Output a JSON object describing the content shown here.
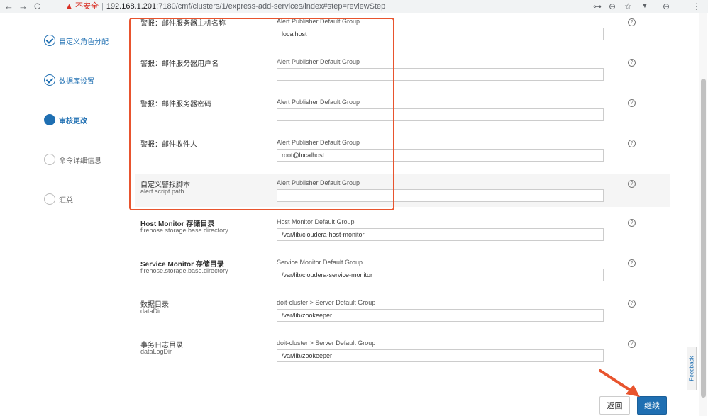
{
  "browser": {
    "back": "←",
    "forward": "→",
    "reload": "C",
    "security_text": "▲ 不安全",
    "host": "192.168.1.201",
    "path": ":7180/cmf/clusters/1/express-add-services/index#step=reviewStep",
    "key_icon": "⊶",
    "zoom_icon": "⊖",
    "star_icon": "☆",
    "ext_icon": "▼",
    "account_icon": "⊖",
    "menu_icon": "⋮"
  },
  "steps": [
    {
      "label": "自定义角色分配",
      "state": "done"
    },
    {
      "label": "数据库设置",
      "state": "done"
    },
    {
      "label": "审核更改",
      "state": "active"
    },
    {
      "label": "命令详细信息",
      "state": "pending"
    },
    {
      "label": "汇总",
      "state": "pending"
    }
  ],
  "configs": [
    {
      "title": "警报：邮件服务器主机名称",
      "sub": "",
      "group": "Alert Publisher Default Group",
      "value": "localhost"
    },
    {
      "title": "警报：邮件服务器用户名",
      "sub": "",
      "group": "Alert Publisher Default Group",
      "value": ""
    },
    {
      "title": "警报：邮件服务器密码",
      "sub": "",
      "group": "Alert Publisher Default Group",
      "value": ""
    },
    {
      "title": "警报：邮件收件人",
      "sub": "",
      "group": "Alert Publisher Default Group",
      "value": "root@localhost"
    },
    {
      "title": "自定义警报脚本",
      "sub": "alert.script.path",
      "group": "Alert Publisher Default Group",
      "value": ""
    },
    {
      "title": "Host Monitor 存储目录",
      "sub": "firehose.storage.base.directory",
      "group": "Host Monitor Default Group",
      "value": "/var/lib/cloudera-host-monitor"
    },
    {
      "title": "Service Monitor 存储目录",
      "sub": "firehose.storage.base.directory",
      "group": "Service Monitor Default Group",
      "value": "/var/lib/cloudera-service-monitor"
    },
    {
      "title": "数据目录",
      "sub": "dataDir",
      "group": "doit-cluster > Server Default Group",
      "value": "/var/lib/zookeeper"
    },
    {
      "title": "事务日志目录",
      "sub": "dataLogDir",
      "group": "doit-cluster > Server Default Group",
      "value": "/var/lib/zookeeper"
    }
  ],
  "help_icon": "?",
  "footer": {
    "back_label": "返回",
    "continue_label": "继续"
  },
  "feedback_label": "Feedback",
  "colors": {
    "accent": "#1f6fb2",
    "highlight": "#e8542e"
  }
}
